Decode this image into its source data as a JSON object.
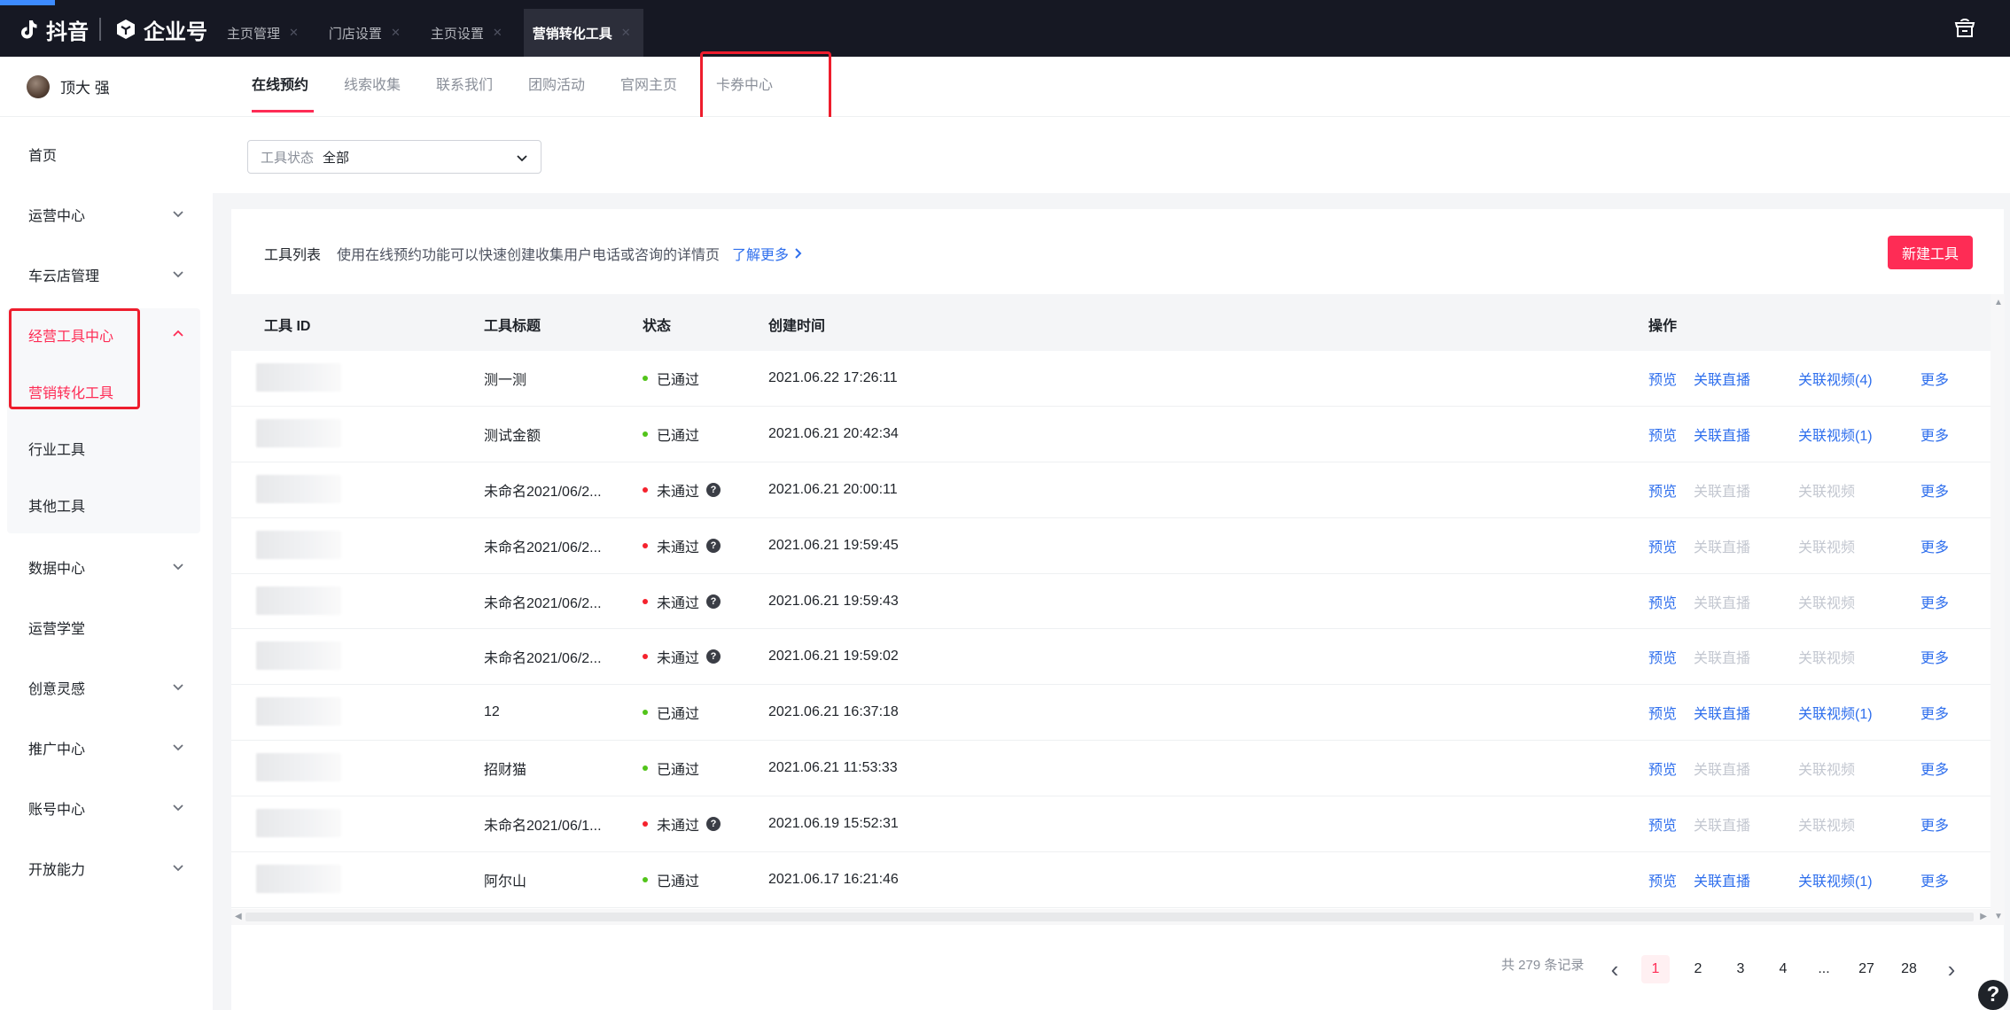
{
  "topbar": {
    "brand": "抖音",
    "enterprise": "企业号",
    "tabs": [
      {
        "label": "主页管理",
        "active": false
      },
      {
        "label": "门店设置",
        "active": false
      },
      {
        "label": "主页设置",
        "active": false
      },
      {
        "label": "营销转化工具",
        "active": true
      }
    ]
  },
  "user": {
    "name": "顶大 强"
  },
  "sidebar": {
    "items": [
      {
        "label": "首页"
      },
      {
        "label": "运营中心"
      },
      {
        "label": "车云店管理"
      },
      {
        "label": "经营工具中心"
      },
      {
        "label": "营销转化工具"
      },
      {
        "label": "行业工具"
      },
      {
        "label": "其他工具"
      },
      {
        "label": "数据中心"
      },
      {
        "label": "运营学堂"
      },
      {
        "label": "创意灵感"
      },
      {
        "label": "推广中心"
      },
      {
        "label": "账号中心"
      },
      {
        "label": "开放能力"
      }
    ]
  },
  "subnav": {
    "tabs": [
      "在线预约",
      "线索收集",
      "联系我们",
      "团购活动",
      "官网主页",
      "卡券中心"
    ]
  },
  "filter": {
    "label": "工具状态",
    "value": "全部"
  },
  "card": {
    "title": "工具列表",
    "description": "使用在线预约功能可以快速创建收集用户电话或咨询的详情页",
    "learn_more": "了解更多",
    "new_button": "新建工具"
  },
  "table": {
    "headers": {
      "id": "工具 ID",
      "title": "工具标题",
      "status": "状态",
      "created": "创建时间",
      "actions": "操作"
    },
    "rows": [
      {
        "title": "测一测",
        "status": "已通过",
        "ok": true,
        "created": "2021.06.22 17:26:11",
        "preview": "预览",
        "live": "关联直播",
        "video": "关联视频(4)",
        "more": "更多"
      },
      {
        "title": "测试金额",
        "status": "已通过",
        "ok": true,
        "created": "2021.06.21 20:42:34",
        "preview": "预览",
        "live": "关联直播",
        "video": "关联视频(1)",
        "more": "更多"
      },
      {
        "title": "未命名2021/06/2...",
        "status": "未通过",
        "ok": false,
        "created": "2021.06.21 20:00:11",
        "preview": "预览",
        "live": "关联直播",
        "video": "关联视频",
        "more": "更多"
      },
      {
        "title": "未命名2021/06/2...",
        "status": "未通过",
        "ok": false,
        "created": "2021.06.21 19:59:45",
        "preview": "预览",
        "live": "关联直播",
        "video": "关联视频",
        "more": "更多"
      },
      {
        "title": "未命名2021/06/2...",
        "status": "未通过",
        "ok": false,
        "created": "2021.06.21 19:59:43",
        "preview": "预览",
        "live": "关联直播",
        "video": "关联视频",
        "more": "更多"
      },
      {
        "title": "未命名2021/06/2...",
        "status": "未通过",
        "ok": false,
        "created": "2021.06.21 19:59:02",
        "preview": "预览",
        "live": "关联直播",
        "video": "关联视频",
        "more": "更多"
      },
      {
        "title": "12",
        "status": "已通过",
        "ok": true,
        "created": "2021.06.21 16:37:18",
        "preview": "预览",
        "live": "关联直播",
        "video": "关联视频(1)",
        "more": "更多"
      },
      {
        "title": "招财猫",
        "status": "已通过",
        "ok": true,
        "created": "2021.06.21 11:53:33",
        "preview": "预览",
        "live": "关联直播",
        "video": "关联视频",
        "more": "更多",
        "live_disabled": true,
        "video_disabled": true
      },
      {
        "title": "未命名2021/06/1...",
        "status": "未通过",
        "ok": false,
        "created": "2021.06.19 15:52:31",
        "preview": "预览",
        "live": "关联直播",
        "video": "关联视频",
        "more": "更多"
      },
      {
        "title": "阿尔山",
        "status": "已通过",
        "ok": true,
        "created": "2021.06.17 16:21:46",
        "preview": "预览",
        "live": "关联直播",
        "video": "关联视频(1)",
        "more": "更多"
      }
    ]
  },
  "pagination": {
    "total": "共 279 条记录",
    "pages": [
      "1",
      "2",
      "3",
      "4",
      "...",
      "27",
      "28"
    ],
    "current": "1"
  },
  "colors": {
    "brand": "#fe2c55",
    "link": "#2f6fed",
    "success": "#52c41a",
    "error": "#f5222d",
    "topbar": "#161823"
  },
  "help": "?"
}
